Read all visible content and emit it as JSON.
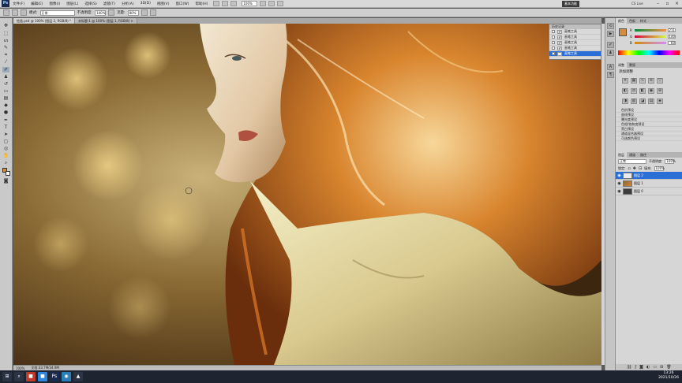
{
  "app": {
    "logo": "Ps",
    "menus": [
      "文件(F)",
      "编辑(E)",
      "图像(I)",
      "图层(L)",
      "选择(S)",
      "滤镜(T)",
      "分析(A)",
      "3D(D)",
      "视图(V)",
      "窗口(W)",
      "帮助(H)"
    ],
    "zoom_select": "100%",
    "workspace_button": "基本功能",
    "cs_live": "CS Live"
  },
  "options": {
    "mode_label": "模式:",
    "mode_value": "正常",
    "opacity_label": "不透明度:",
    "opacity_value": "100%",
    "flow_label": "流量:",
    "flow_value": "80%"
  },
  "doc_tabs": [
    {
      "label": "绘画.psd @ 100% (图层 2, RGB/8) *"
    },
    {
      "label": "未标题-1 @ 100% (图层 1, RGB/8) ×"
    }
  ],
  "status": {
    "zoom": "100%",
    "doc_info": "文档:33.7M/34.9M"
  },
  "history": {
    "tab": "历史记录",
    "rows": [
      "画笔工具",
      "画笔工具",
      "画笔工具",
      "画笔工具",
      "画笔工具"
    ]
  },
  "color_panel": {
    "tabs": [
      "颜色",
      "色板",
      "样式"
    ],
    "channels": [
      {
        "name": "R",
        "value": "211"
      },
      {
        "name": "G",
        "value": "140"
      },
      {
        "name": "B",
        "value": "60"
      }
    ],
    "foreground": "#d38c3c"
  },
  "adjust_panel": {
    "tabs": [
      "调整",
      "蒙版"
    ],
    "title": "添加调整",
    "presets": [
      "色阶预设",
      "曲线预设",
      "曝光度预设",
      "色相/饱和度预设",
      "黑白预设",
      "通道混合器预设",
      "可选颜色预设"
    ]
  },
  "layers_panel": {
    "tabs": [
      "图层",
      "通道",
      "路径"
    ],
    "blend_mode": "正常",
    "opacity_label": "不透明度:",
    "opacity_value": "100%",
    "lock_label": "锁定:",
    "fill_label": "填充:",
    "fill_value": "100%",
    "layers": [
      {
        "name": "图层 2",
        "selected": true
      },
      {
        "name": "图层 1",
        "selected": false
      },
      {
        "name": "图层 0",
        "selected": false
      }
    ]
  },
  "taskbar": {
    "time": "13:26",
    "date": "2021/10/26"
  },
  "colors": {
    "accent": "#2a6fd6",
    "ui_gray": "#d6d6d6",
    "taskbar": "#1e2430"
  }
}
